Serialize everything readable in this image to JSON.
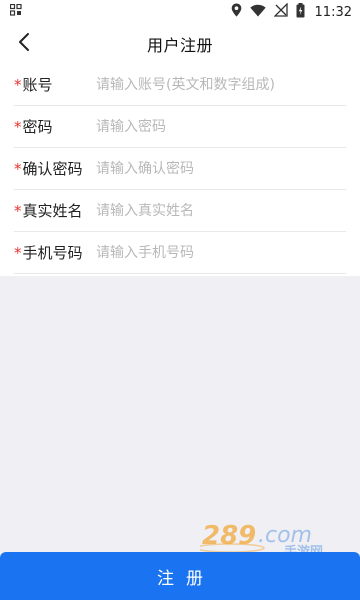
{
  "status_bar": {
    "time": "11:32",
    "icons": [
      "grid-icon",
      "location-icon",
      "wifi-icon",
      "signal-icon",
      "battery-icon"
    ]
  },
  "header": {
    "title": "用户注册",
    "back_icon": "chevron-left-icon"
  },
  "form": {
    "required_mark": "*",
    "fields": [
      {
        "label": "账号",
        "placeholder": "请输入账号(英文和数字组成)",
        "value": ""
      },
      {
        "label": "密码",
        "placeholder": "请输入密码",
        "value": ""
      },
      {
        "label": "确认密码",
        "placeholder": "请输入确认密码",
        "value": ""
      },
      {
        "label": "真实姓名",
        "placeholder": "请输入真实姓名",
        "value": ""
      },
      {
        "label": "手机号码",
        "placeholder": "请输入手机号码",
        "value": ""
      }
    ]
  },
  "watermark": {
    "text": "289.com",
    "subtext": "手游网"
  },
  "submit": {
    "label": "注册"
  },
  "colors": {
    "accent": "#1a73f0",
    "required": "#e8332e",
    "background": "#efeff4",
    "placeholder": "#b8b8b8"
  }
}
